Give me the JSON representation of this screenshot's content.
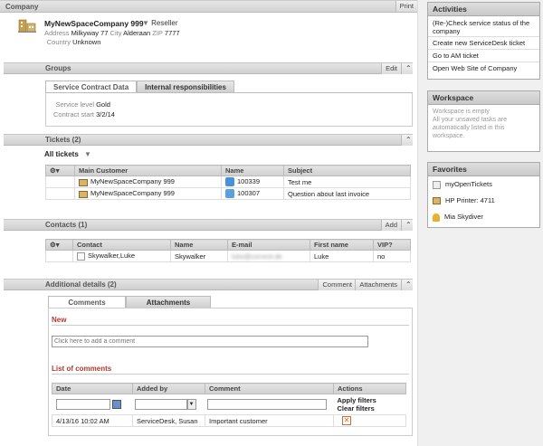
{
  "company": {
    "header": "Company",
    "print": "Print",
    "name": "MyNewSpaceCompany 999",
    "type": "Reseller",
    "address_label": "Address",
    "address": "Milkyway 77",
    "city_label": "City",
    "city": "Alderaan",
    "zip_label": "ZIP",
    "zip": "7777",
    "country_label": "Country",
    "country": "Unknown"
  },
  "groups": {
    "title": "Groups",
    "edit": "Edit",
    "tabs": [
      "Service Contract Data",
      "Internal responsibilities"
    ],
    "service_level_label": "Service level",
    "service_level": "Gold",
    "contract_start_label": "Contract start",
    "contract_start": "3/2/14"
  },
  "tickets": {
    "title": "Tickets (2)",
    "filter": "All tickets",
    "columns": [
      "Main Customer",
      "Name",
      "Subject"
    ],
    "rows": [
      {
        "customer": "MyNewSpaceCompany 999",
        "name": "100339",
        "subject": "Test me"
      },
      {
        "customer": "MyNewSpaceCompany 999",
        "name": "100307",
        "subject": "Question about last invoice"
      }
    ]
  },
  "contacts": {
    "title": "Contacts (1)",
    "add": "Add",
    "columns": [
      "Contact",
      "Name",
      "E-mail",
      "First name",
      "VIP?"
    ],
    "rows": [
      {
        "contact": "Skywalker,Luke",
        "name": "Skywalker",
        "email": "luke@corvest.de",
        "first": "Luke",
        "vip": "no"
      }
    ]
  },
  "details": {
    "title": "Additional details (2)",
    "comment_btn": "Comment",
    "attachments_btn": "Attachments",
    "tabs": [
      "Comments",
      "Attachments"
    ],
    "new_label": "New",
    "comment_placeholder": "Click here to add a comment",
    "list_label": "List of comments",
    "columns": [
      "Date",
      "Added by",
      "Comment",
      "Actions"
    ],
    "apply": "Apply filters",
    "clear": "Clear filters",
    "rows": [
      {
        "date": "4/13/16 10:02 AM",
        "by": "ServiceDesk, Susan",
        "comment": "Important customer"
      }
    ]
  },
  "activities": {
    "title": "Activities",
    "items": [
      "(Re-)Check service status of the company",
      "Create new ServiceDesk ticket",
      "Go to AM ticket",
      "Open Web Site of Company"
    ]
  },
  "workspace": {
    "title": "Workspace",
    "text": "Workspace is empty\nAll your unsaved tasks are automatically listed in this workspace."
  },
  "favorites": {
    "title": "Favorites",
    "items": [
      "myOpenTickets",
      "HP Printer: 4711",
      "Mia Skydiver"
    ]
  },
  "colors": {
    "accent_red": "#b03a2e",
    "header_grey": "#d3d3d3"
  }
}
